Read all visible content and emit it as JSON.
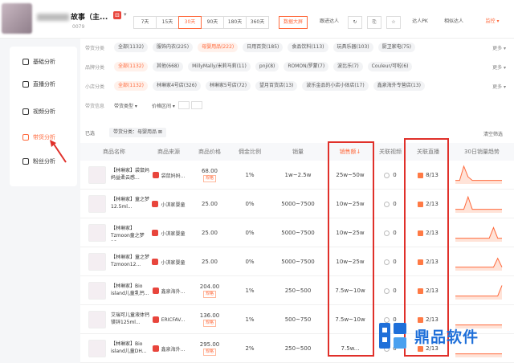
{
  "header": {
    "shop_name": "故事（主...",
    "shop_id": "0079",
    "shop_badge": "⊟",
    "days": [
      "7天",
      "15天",
      "30天",
      "90天",
      "180天",
      "360天"
    ],
    "active_day": "30天",
    "big_screen": "数据大屏",
    "follow_talent": "跟进达人",
    "talent_pk": "达人PK",
    "similar_talent": "相似达人",
    "collect": "监控"
  },
  "sidebar": {
    "items": [
      {
        "label": "基础分析",
        "icon": "chart-icon"
      },
      {
        "label": "直播分析",
        "icon": "live-icon"
      },
      {
        "label": "视频分析",
        "icon": "video-icon"
      },
      {
        "label": "带货分析",
        "icon": "cart-icon"
      },
      {
        "label": "粉丝分析",
        "icon": "user-icon"
      }
    ],
    "active": "带货分析"
  },
  "filters": {
    "category": {
      "label": "带货分类",
      "chips": [
        "全部(1132)",
        "服饰内衣(225)",
        "母婴用品(222)",
        "日用百货(185)",
        "食品饮料(113)",
        "玩具乐器(103)",
        "厨卫家电(75)"
      ],
      "active": 2
    },
    "brand": {
      "label": "品牌分类",
      "chips": [
        "全部(1132)",
        "其他(668)",
        "MillyMally/米莉马莉(11)",
        "pnji(8)",
        "ROMON/罗蒙(7)",
        "波比乐(7)",
        "Couleur/可啦(6)"
      ],
      "active": 0
    },
    "shop": {
      "label": "小店分类",
      "chips": [
        "全部(1132)",
        "林琳家4号店(326)",
        "林琳家5号店(72)",
        "望月百货店(13)",
        "波乐金品的小店小体店(17)",
        "鑫泉海外专营店(13)"
      ],
      "active": 0
    },
    "info": {
      "label": "带货信息",
      "type_select": "带货类型",
      "price_select": "价格区间"
    },
    "more": "更多"
  },
  "selected": {
    "label": "已选",
    "tag": "带货分类：母婴用品",
    "clear": "清空筛选"
  },
  "table": {
    "headers": [
      "商品名称",
      "商品来源",
      "商品价格",
      "佣金比例",
      "销量",
      "销售额",
      "关联视频",
      "关联直播",
      "30日销量趋势"
    ],
    "sort_marker": "销售额↓",
    "rows": [
      {
        "name": "【林琳家】袋鼠妈妈益柔云感...",
        "source": "袋鼠妈妈...",
        "price": "68.00",
        "spec": "规格",
        "commission": "1%",
        "sales": "1w~2.5w",
        "revenue": "25w~50w",
        "videos": "0",
        "lives": "8/13",
        "trend": [
          0.2,
          0.2,
          1.0,
          0.4,
          0.2,
          0.2,
          0.2,
          0.2,
          0.2,
          0.2,
          0.2,
          0.2
        ]
      },
      {
        "name": "【林琳家】童之梦12.5ml...",
        "source": "小淇家婴童",
        "price": "25.00",
        "spec": "",
        "commission": "0%",
        "sales": "5000~7500",
        "revenue": "10w~25w",
        "videos": "0",
        "lives": "2/13",
        "trend": [
          0.2,
          0.2,
          0.2,
          0.9,
          0.2,
          0.2,
          0.2,
          0.2,
          0.2,
          0.2,
          0.2,
          0.2
        ]
      },
      {
        "name": "【林琳家】Tzmoon童之梦12...",
        "source": "小淇家婴童",
        "price": "25.00",
        "spec": "",
        "commission": "0%",
        "sales": "5000~7500",
        "revenue": "10w~25w",
        "videos": "0",
        "lives": "2/13",
        "trend": [
          0.2,
          0.2,
          0.2,
          0.2,
          0.2,
          0.2,
          0.2,
          0.2,
          0.2,
          0.8,
          0.2,
          0.2
        ]
      },
      {
        "name": "【林琳家】童之梦Tzmoon12...",
        "source": "小淇家婴童",
        "price": "25.00",
        "spec": "",
        "commission": "0%",
        "sales": "5000~7500",
        "revenue": "10w~25w",
        "videos": "0",
        "lives": "2/13",
        "trend": [
          0.2,
          0.2,
          0.2,
          0.2,
          0.2,
          0.2,
          0.2,
          0.2,
          0.2,
          0.2,
          0.7,
          0.2
        ]
      },
      {
        "name": "【林琳家】Bio island儿童乳钙...",
        "source": "鑫泉海外...",
        "price": "204.00",
        "spec": "规格",
        "commission": "1%",
        "sales": "250~500",
        "revenue": "7.5w~10w",
        "videos": "0",
        "lives": "2/13",
        "trend": [
          0.2,
          0.2,
          0.2,
          0.2,
          0.2,
          0.2,
          0.2,
          0.2,
          0.2,
          0.2,
          0.2,
          0.8
        ]
      },
      {
        "name": "艾瑞可儿童液体钙镁锌125ml...",
        "source": "ERICFAV...",
        "price": "136.00",
        "spec": "规格",
        "commission": "1%",
        "sales": "500~750",
        "revenue": "7.5w~10w",
        "videos": "0",
        "lives": "2/13",
        "trend": [
          0.2,
          0.2,
          0.2,
          0.2,
          0.2,
          0.2,
          0.2,
          0.2,
          0.2,
          0.2,
          0.2,
          0.2
        ]
      },
      {
        "name": "【林琳家】Bio island儿童DH...",
        "source": "鑫泉海外...",
        "price": "295.00",
        "spec": "规格",
        "commission": "2%",
        "sales": "250~500",
        "revenue": "7.5w...",
        "videos": "0",
        "lives": "2/13",
        "trend": [
          0.2,
          0.2,
          0.2,
          0.2,
          0.2,
          0.2,
          0.2,
          0.2,
          0.2,
          0.2,
          0.2,
          0.2
        ]
      }
    ]
  },
  "watermark": {
    "text": "鼎品软件"
  },
  "colors": {
    "accent": "#ff6a3d",
    "annotation": "#e0302a",
    "watermark": "#1e6fd9"
  }
}
